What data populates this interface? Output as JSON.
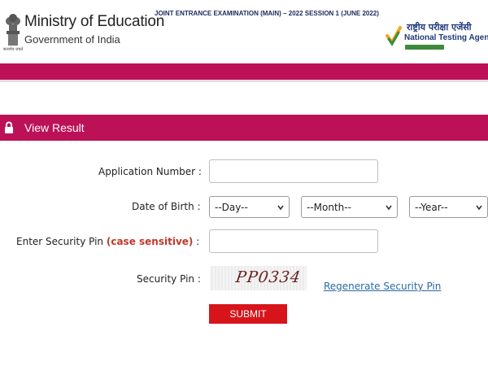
{
  "header": {
    "ministry_title": "Ministry of Education",
    "ministry_sub": "Government of India",
    "emblem_caption": "सत्यमेव जयते",
    "exam_title": "JOINT ENTRANCE EXAMINATION (MAIN) – 2022 SESSION 1 (JUNE 2022)",
    "nta_hindi": "राष्ट्रीय परीक्षा एजेंसी",
    "nta_name": "National Testing Agency",
    "icons": [
      "national-emblem-icon",
      "nta-check-icon"
    ]
  },
  "colors": {
    "brand_magenta": "#bd1157",
    "submit_red": "#d7141a",
    "link_blue": "#2a6aa8",
    "required_red": "#c0392b"
  },
  "result_bar": {
    "title": "View Result",
    "icon": "lock-icon"
  },
  "form": {
    "application_label": "Application Number :",
    "application_value": "",
    "dob_label": "Date of Birth :",
    "day_selected": "--Day--",
    "month_selected": "--Month--",
    "year_selected": "--Year--",
    "pin_label_prefix": "Enter Security Pin",
    "pin_label_required": "(case sensitive)",
    "pin_label_suffix": ":",
    "pin_value": "",
    "security_pin_label": "Security Pin :",
    "captcha_text": "PP0334",
    "regenerate_label": "Regenerate Security Pin",
    "submit_label": "SUBMIT"
  }
}
